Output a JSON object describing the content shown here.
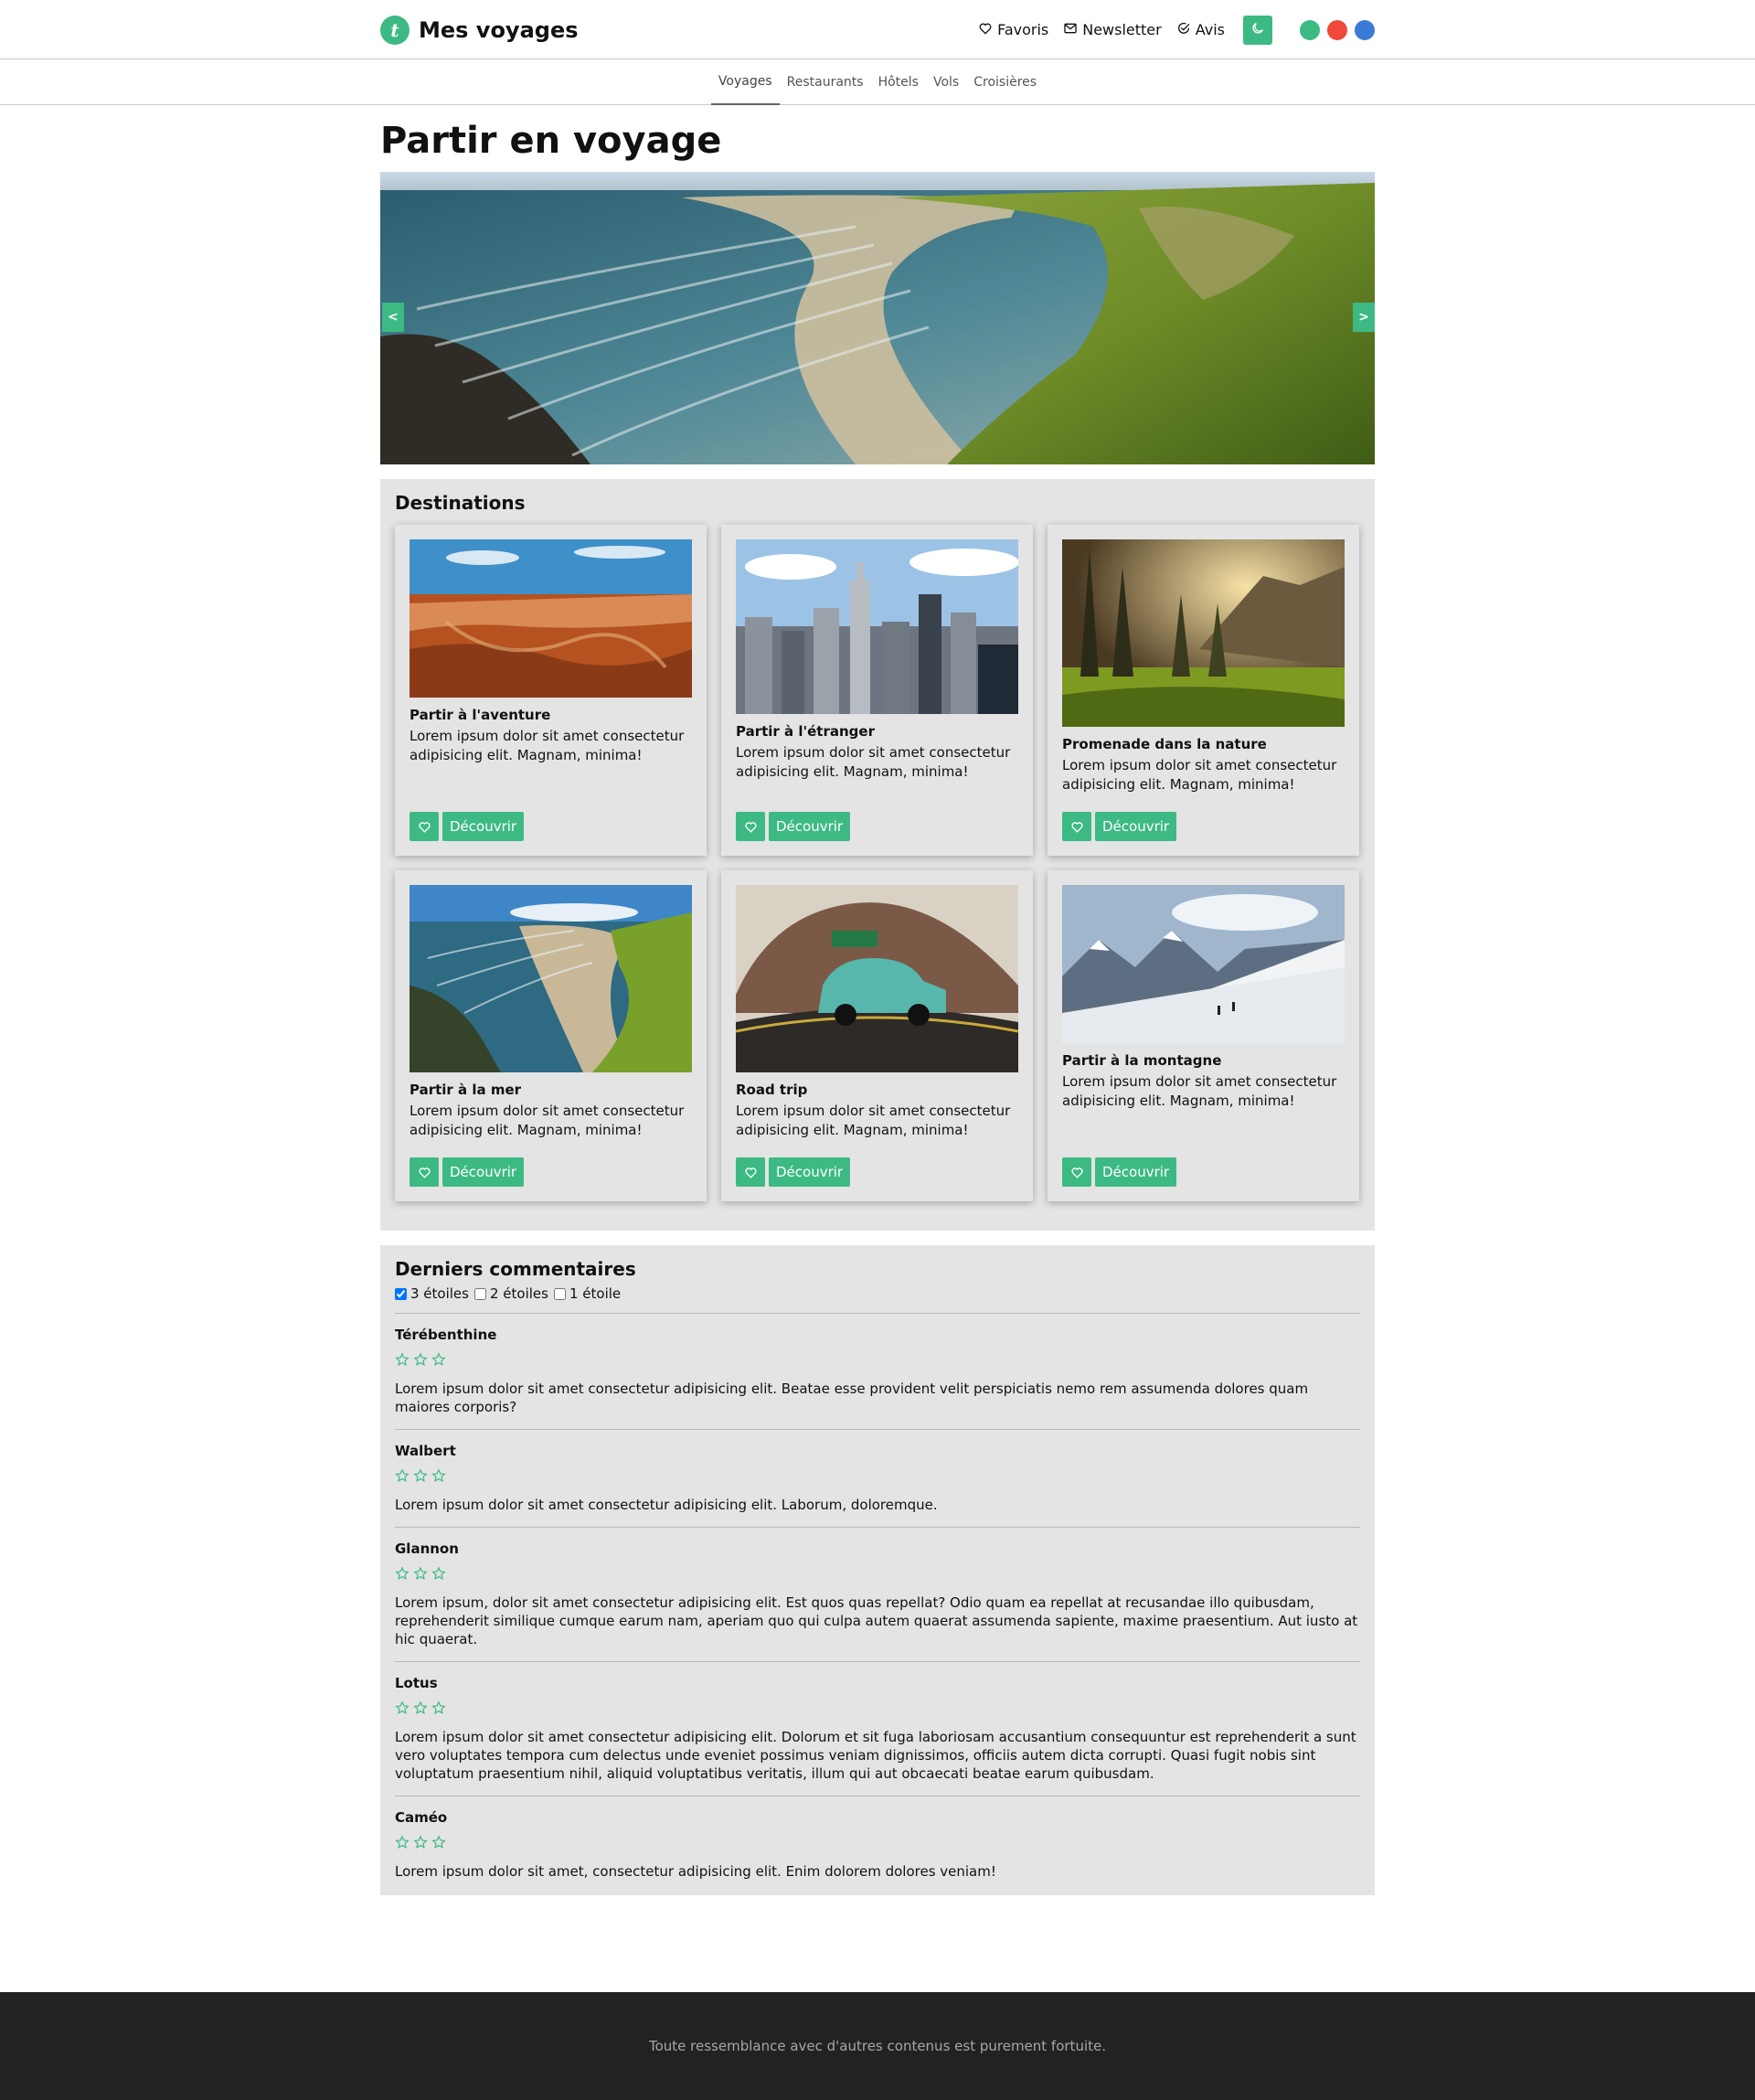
{
  "header": {
    "logo_letter": "t",
    "title": "Mes voyages",
    "links": [
      {
        "icon": "heart-icon",
        "label": "Favoris"
      },
      {
        "icon": "envelope-icon",
        "label": "Newsletter"
      },
      {
        "icon": "check-circle-icon",
        "label": "Avis"
      }
    ],
    "theme_icon": "moon-icon",
    "color_options": [
      "#3dba84",
      "#f0493b",
      "#3a7bd5"
    ]
  },
  "subnav": {
    "items": [
      "Voyages",
      "Restaurants",
      "Hôtels",
      "Vols",
      "Croisières"
    ],
    "active": "Voyages"
  },
  "page_title": "Partir en voyage",
  "carousel": {
    "prev_label": "<",
    "next_label": ">"
  },
  "destinations": {
    "title": "Destinations",
    "fav_icon": "heart-icon",
    "button_label": "Découvrir",
    "cards": [
      {
        "title": "Partir à l'aventure",
        "text": "Lorem ipsum dolor sit amet consectetur adipisicing elit. Magnam, minima!",
        "image": "canyon"
      },
      {
        "title": "Partir à l'étranger",
        "text": "Lorem ipsum dolor sit amet consectetur adipisicing elit. Magnam, minima!",
        "image": "city"
      },
      {
        "title": "Promenade dans la nature",
        "text": "Lorem ipsum dolor sit amet consectetur adipisicing elit. Magnam, minima!",
        "image": "forest"
      },
      {
        "title": "Partir à la mer",
        "text": "Lorem ipsum dolor sit amet consectetur adipisicing elit. Magnam, minima!",
        "image": "sea"
      },
      {
        "title": "Road trip",
        "text": "Lorem ipsum dolor sit amet consectetur adipisicing elit. Magnam, minima!",
        "image": "car"
      },
      {
        "title": "Partir à la montagne",
        "text": "Lorem ipsum dolor sit amet consectetur adipisicing elit. Magnam, minima!",
        "image": "mountain"
      }
    ]
  },
  "comments": {
    "title": "Derniers commentaires",
    "filters": [
      {
        "label": "3 étoiles",
        "checked": true
      },
      {
        "label": "2 étoiles",
        "checked": false
      },
      {
        "label": "1 étoile",
        "checked": false
      }
    ],
    "items": [
      {
        "author": "Térébenthine",
        "stars": 3,
        "text": "Lorem ipsum dolor sit amet consectetur adipisicing elit. Beatae esse provident velit perspiciatis nemo rem assumenda dolores quam maiores corporis?"
      },
      {
        "author": "Walbert",
        "stars": 3,
        "text": "Lorem ipsum dolor sit amet consectetur adipisicing elit. Laborum, doloremque."
      },
      {
        "author": "Glannon",
        "stars": 3,
        "text": "Lorem ipsum, dolor sit amet consectetur adipisicing elit. Est quos quas repellat? Odio quam ea repellat at recusandae illo quibusdam, reprehenderit similique cumque earum nam, aperiam quo qui culpa autem quaerat assumenda sapiente, maxime praesentium. Aut iusto at hic quaerat."
      },
      {
        "author": "Lotus",
        "stars": 3,
        "text": "Lorem ipsum dolor sit amet consectetur adipisicing elit. Dolorum et sit fuga laboriosam accusantium consequuntur est reprehenderit a sunt vero voluptates tempora cum delectus unde eveniet possimus veniam dignissimos, officiis autem dicta corrupti. Quasi fugit nobis sint voluptatum praesentium nihil, aliquid voluptatibus veritatis, illum qui aut obcaecati beatae earum quibusdam."
      },
      {
        "author": "Caméo",
        "stars": 3,
        "text": "Lorem ipsum dolor sit amet, consectetur adipisicing elit. Enim dolorem dolores veniam!"
      }
    ]
  },
  "footer": {
    "text": "Toute ressemblance avec d'autres contenus est purement fortuite."
  }
}
